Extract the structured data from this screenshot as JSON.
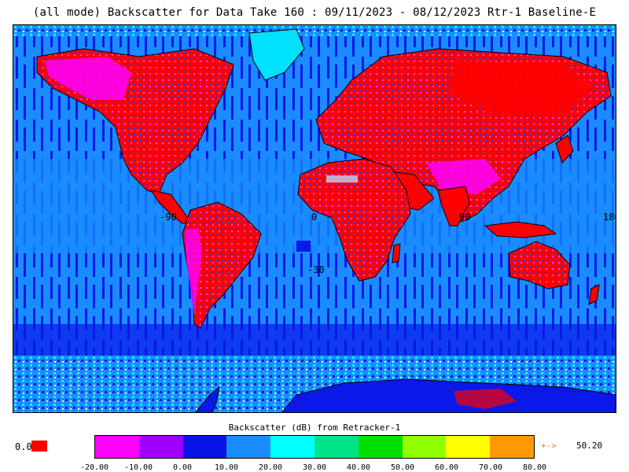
{
  "title": "(all mode) Backscatter for Data Take 160 : 09/11/2023 - 08/12/2023 Rtr-1 Baseline-E",
  "map": {
    "ocean_color": "#1a8cff",
    "ocean_dark_color": "#0a18e8",
    "land_high_color": "#ff0000",
    "land_mid_color": "#3030c0",
    "ice_color": "#00e0ff",
    "coast_color": "#000000",
    "gridline_labels": {
      "lon_minus90": "-90",
      "lon_0": "0",
      "lon_90": "90",
      "lon_180": "180",
      "lat_minus30": "-30"
    }
  },
  "legend": {
    "title": "Backscatter (dB) from Retracker-1",
    "nodata_label": "0.0",
    "nodata_color": "#ff0000",
    "colors": [
      "#ff00ff",
      "#a000ff",
      "#0a14e8",
      "#1a8cff",
      "#00ffff",
      "#00e28a",
      "#00e000",
      "#90ff00",
      "#ffff00",
      "#ff9900"
    ],
    "ticks": [
      "-20.00",
      "-10.00",
      "0.00",
      "10.00",
      "20.00",
      "30.00",
      "40.00",
      "50.00",
      "60.00",
      "70.00",
      "80.00"
    ],
    "max_arrow": "+->",
    "max_value": "50.20"
  }
}
